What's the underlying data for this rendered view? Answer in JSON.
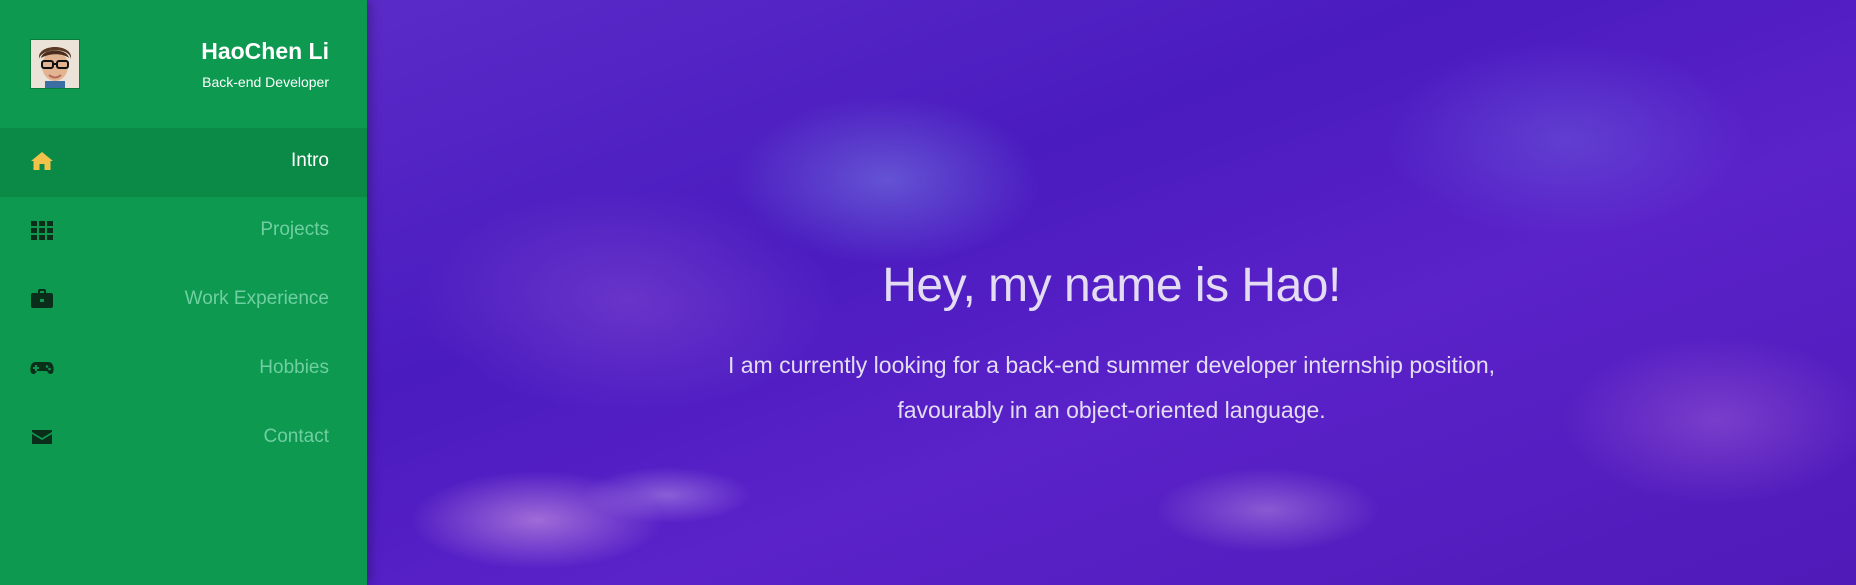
{
  "profile": {
    "name": "HaoChen Li",
    "role": "Back-end Developer"
  },
  "nav": {
    "items": [
      {
        "label": "Intro",
        "icon": "home-icon",
        "active": true
      },
      {
        "label": "Projects",
        "icon": "grid-icon",
        "active": false
      },
      {
        "label": "Work Experience",
        "icon": "briefcase-icon",
        "active": false
      },
      {
        "label": "Hobbies",
        "icon": "gamepad-icon",
        "active": false
      },
      {
        "label": "Contact",
        "icon": "envelope-icon",
        "active": false
      }
    ]
  },
  "hero": {
    "title": "Hey, my name is Hao!",
    "line1": "I am currently looking for a back-end summer developer internship position,",
    "line2": "favourably in an object-oriented language."
  },
  "colors": {
    "sidebar": "#0d9950",
    "sidebar_active": "#0b8a47",
    "home_icon": "#f3c24b",
    "hero_bg": "#4a1bbf"
  }
}
